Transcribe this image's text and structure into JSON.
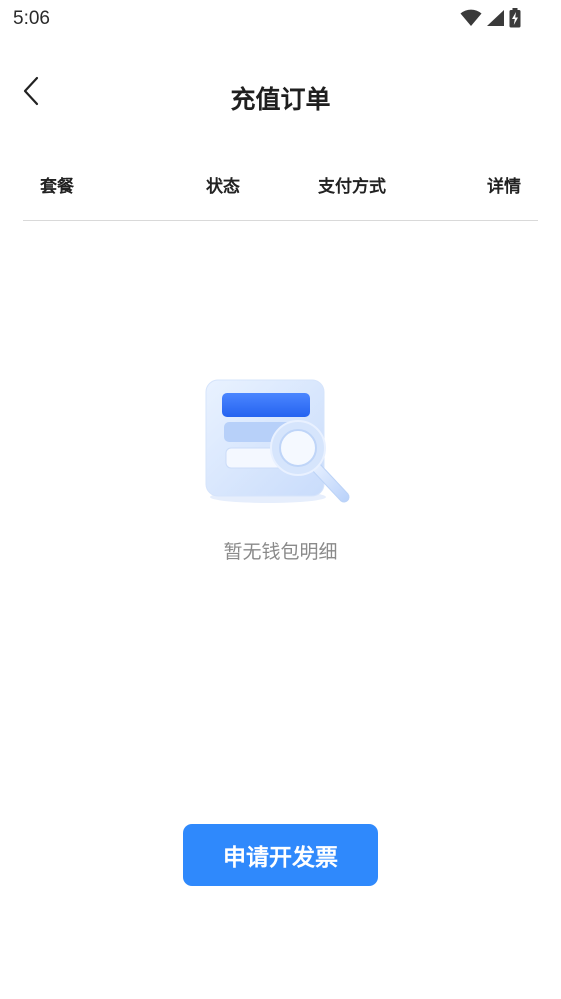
{
  "status_bar": {
    "time": "5:06",
    "icons": [
      "wifi-icon",
      "signal-icon",
      "battery-charging-icon"
    ]
  },
  "header": {
    "back_icon": "chevron-left-icon",
    "title": "充值订单"
  },
  "table": {
    "columns": [
      "套餐",
      "状态",
      "支付方式",
      "详情"
    ]
  },
  "empty_state": {
    "illustration": "search-list-illustration",
    "message": "暂无钱包明细"
  },
  "footer": {
    "invoice_button_label": "申请开发票"
  },
  "colors": {
    "primary": "#2f89fc",
    "divider": "#d9d9d9",
    "muted_text": "#8a8a8a"
  }
}
